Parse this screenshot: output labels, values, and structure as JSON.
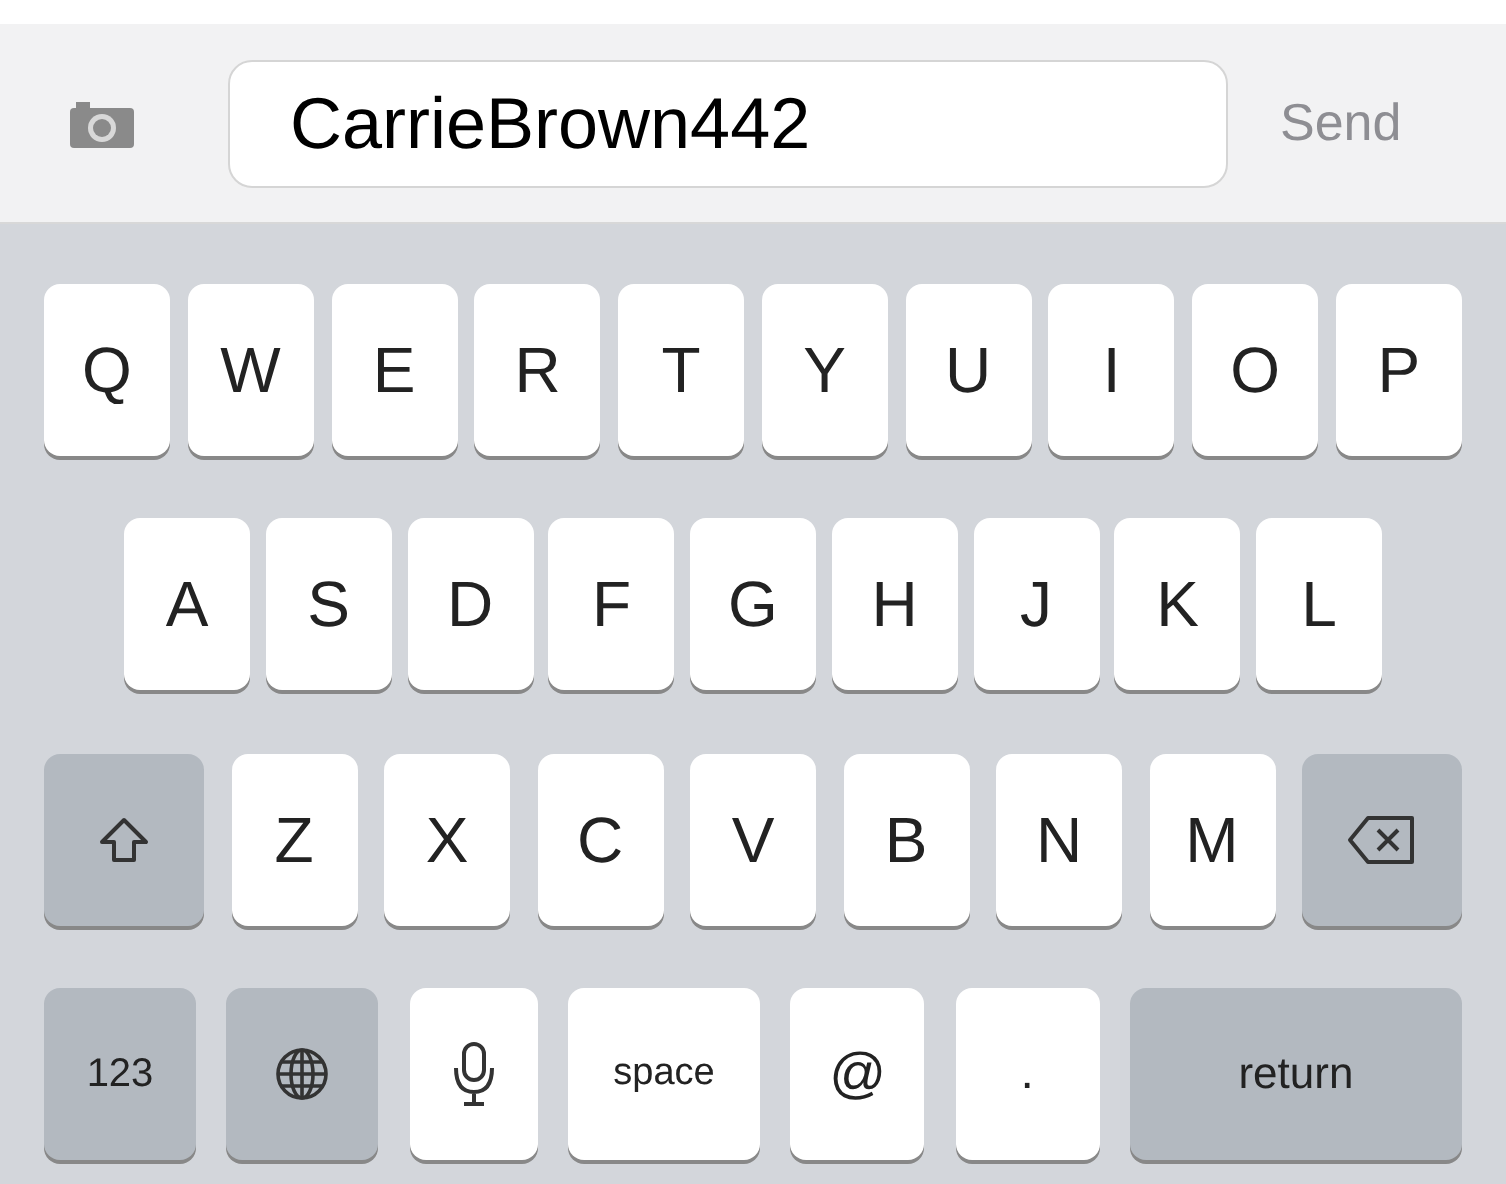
{
  "message_bar": {
    "value": "CarrieBrown442",
    "send": "Send"
  },
  "keyboard": {
    "letter_row_top": [
      {
        "kind": "letter",
        "label": "Q"
      },
      {
        "kind": "letter",
        "label": "W"
      },
      {
        "kind": "letter",
        "label": "E"
      },
      {
        "kind": "letter",
        "label": "R"
      },
      {
        "kind": "letter",
        "label": "T"
      },
      {
        "kind": "letter",
        "label": "Y"
      },
      {
        "kind": "letter",
        "label": "U"
      },
      {
        "kind": "letter",
        "label": "I"
      },
      {
        "kind": "letter",
        "label": "O"
      },
      {
        "kind": "letter",
        "label": "P"
      }
    ],
    "letter_row_middle": [
      {
        "kind": "letter",
        "label": "A"
      },
      {
        "kind": "letter",
        "label": "S"
      },
      {
        "kind": "letter",
        "label": "D"
      },
      {
        "kind": "letter",
        "label": "F"
      },
      {
        "kind": "letter",
        "label": "G"
      },
      {
        "kind": "letter",
        "label": "H"
      },
      {
        "kind": "letter",
        "label": "J"
      },
      {
        "kind": "letter",
        "label": "K"
      },
      {
        "kind": "letter",
        "label": "L"
      }
    ],
    "letter_row_bottom": [
      {
        "kind": "shift"
      },
      {
        "kind": "letter",
        "label": "Z"
      },
      {
        "kind": "letter",
        "label": "X"
      },
      {
        "kind": "letter",
        "label": "C"
      },
      {
        "kind": "letter",
        "label": "V"
      },
      {
        "kind": "letter",
        "label": "B"
      },
      {
        "kind": "letter",
        "label": "N"
      },
      {
        "kind": "letter",
        "label": "M"
      },
      {
        "kind": "backspace"
      }
    ],
    "function_row": [
      {
        "kind": "numbers",
        "label": "123"
      },
      {
        "kind": "globe"
      },
      {
        "kind": "mic"
      },
      {
        "kind": "space",
        "label": "space"
      },
      {
        "kind": "at",
        "label": "@"
      },
      {
        "kind": "period",
        "label": "."
      },
      {
        "kind": "return",
        "label": "return"
      }
    ]
  }
}
